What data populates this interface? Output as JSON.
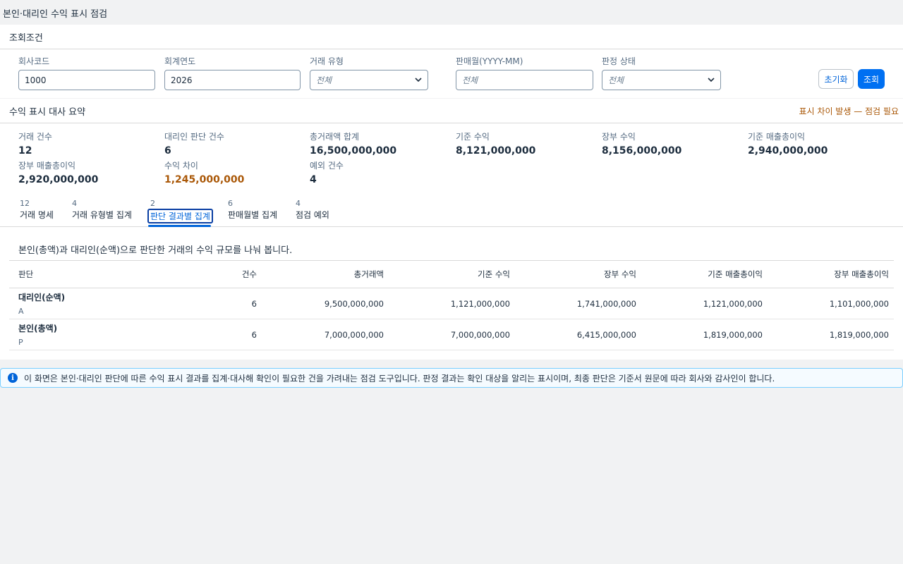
{
  "page": {
    "title": "본인·대리인 수익 표시 점검"
  },
  "filters": {
    "header": "조회조건",
    "company": {
      "label": "회사코드",
      "value": "1000"
    },
    "year": {
      "label": "회계연도",
      "value": "2026"
    },
    "txn_type": {
      "label": "거래 유형",
      "placeholder": "전체"
    },
    "sale_month": {
      "label": "판매월(YYYY-MM)",
      "placeholder": "전체"
    },
    "status": {
      "label": "판정 상태",
      "placeholder": "전체"
    },
    "reset_label": "초기화",
    "search_label": "조회"
  },
  "summary": {
    "header": "수익 표시 대사 요약",
    "warning": "표시 차이 발생 — 점검 필요",
    "metrics": [
      {
        "label": "거래 건수",
        "value": "12"
      },
      {
        "label": "대리인 판단 건수",
        "value": "6"
      },
      {
        "label": "총거래액 합계",
        "value": "16,500,000,000"
      },
      {
        "label": "기준 수익",
        "value": "8,121,000,000"
      },
      {
        "label": "장부 수익",
        "value": "8,156,000,000"
      },
      {
        "label": "기준 매출총이익",
        "value": "2,940,000,000"
      },
      {
        "label": "장부 매출총이익",
        "value": "2,920,000,000"
      },
      {
        "label": "수익 차이",
        "value": "1,245,000,000"
      },
      {
        "label": "예외 건수",
        "value": "4"
      }
    ],
    "highlight_color": "#aa5808"
  },
  "tabs": [
    {
      "count": "12",
      "label": "거래 명세"
    },
    {
      "count": "4",
      "label": "거래 유형별 집계"
    },
    {
      "count": "2",
      "label": "판단 결과별 집계"
    },
    {
      "count": "6",
      "label": "판매월별 집계"
    },
    {
      "count": "4",
      "label": "점검 예외"
    }
  ],
  "active_tab": "판단 결과별 집계",
  "content": {
    "description": "본인(총액)과 대리인(순액)으로 판단한 거래의 수익 규모를 나눠 봅니다.",
    "columns": [
      "판단",
      "건수",
      "총거래액",
      "기준 수익",
      "장부 수익",
      "기준 매출총이익",
      "장부 매출총이익"
    ],
    "rows": [
      {
        "judgement": "대리인(순액)",
        "code": "A",
        "count": "6",
        "gross": "9,500,000,000",
        "std_revenue": "1,121,000,000",
        "book_revenue": "1,741,000,000",
        "std_margin": "1,121,000,000",
        "book_margin": "1,101,000,000"
      },
      {
        "judgement": "본인(총액)",
        "code": "P",
        "count": "6",
        "gross": "7,000,000,000",
        "std_revenue": "7,000,000,000",
        "book_revenue": "6,415,000,000",
        "std_margin": "1,819,000,000",
        "book_margin": "1,819,000,000"
      }
    ]
  },
  "info": {
    "icon": "info-icon",
    "text": "이 화면은 본인·대리인 판단에 따른 수익 표시 결과를 집계·대사해 확인이 필요한 건을 가려내는 점검 도구입니다. 판정 결과는 확인 대상을 알리는 표시이며, 최종 판단은 기준서 원문에 따라 회사와 감사인이 합니다."
  }
}
